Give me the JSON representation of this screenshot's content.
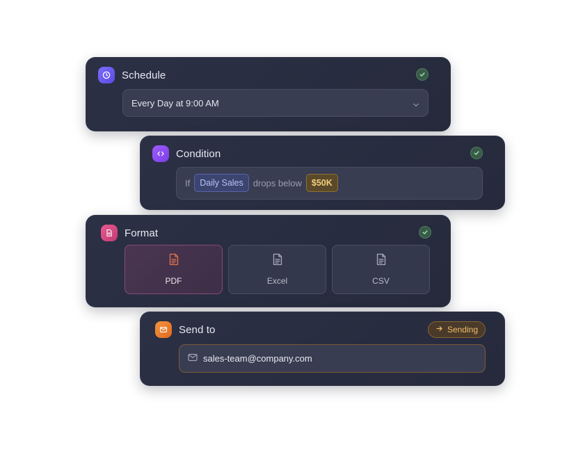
{
  "schedule": {
    "title": "Schedule",
    "icon": "clock-icon",
    "icon_color": "#6a5cf0",
    "value": "Every Day at 9:00 AM",
    "status": "complete"
  },
  "condition": {
    "title": "Condition",
    "icon": "code-icon",
    "icon_color": "#8e4cf0",
    "prefix": "If",
    "metric": "Daily Sales",
    "operator": "drops below",
    "threshold": "$50K",
    "status": "complete"
  },
  "format": {
    "title": "Format",
    "icon": "document-icon",
    "icon_color": "#d9467f",
    "options": [
      {
        "label": "PDF",
        "selected": true
      },
      {
        "label": "Excel",
        "selected": false
      },
      {
        "label": "CSV",
        "selected": false
      }
    ],
    "status": "complete"
  },
  "send_to": {
    "title": "Send to",
    "icon": "mail-icon",
    "icon_color": "#ef7a2a",
    "status_label": "Sending",
    "email": "sales-team@company.com"
  },
  "colors": {
    "card_bg": "#2a2e42",
    "check_green": "#8fd3a4",
    "accent_gold": "#f2cd7c",
    "accent_blue": "#b8c3f5"
  }
}
